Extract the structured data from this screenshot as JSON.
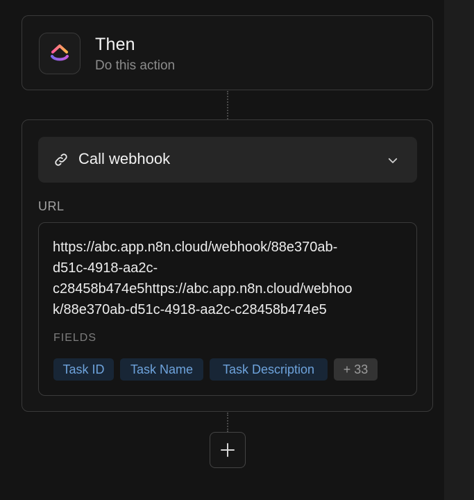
{
  "trigger_card": {
    "title": "Then",
    "subtitle": "Do this action",
    "app_icon": "clickup-logo-icon"
  },
  "action_card": {
    "action": {
      "icon": "link-icon",
      "label": "Call webhook",
      "dropdown_icon": "chevron-down-icon"
    },
    "url_label": "URL",
    "url_lines": [
      "https://abc.app.n8n.cloud/webhook/88e370ab-",
      "d51c-4918-aa2c-",
      "c28458b474e5https://abc.app.n8n.cloud/webhoo",
      "k/88e370ab-d51c-4918-aa2c-c28458b474e5"
    ],
    "fields_label": "FIELDS",
    "fields": [
      "Task ID",
      "Task Name",
      "Task Description"
    ],
    "more_fields": "+ 33",
    "colors": {
      "tag_background": "#182636",
      "tag_text": "#6ea3dc"
    }
  },
  "add_step": {
    "icon": "plus-icon"
  }
}
